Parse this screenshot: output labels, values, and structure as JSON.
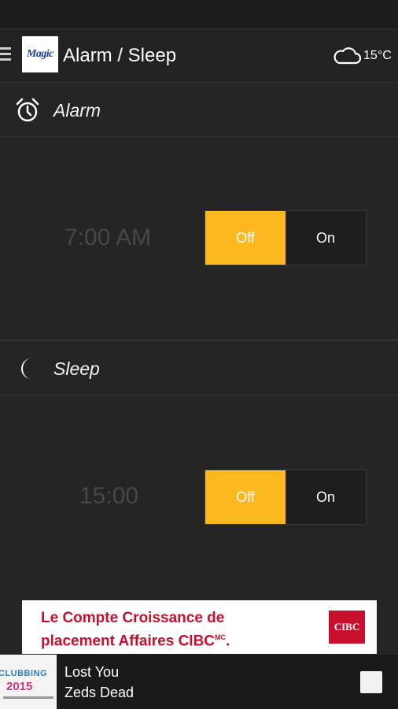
{
  "header": {
    "title": "Alarm / Sleep",
    "logo_text": "Magic",
    "temperature": "15°C"
  },
  "alarm": {
    "label": "Alarm",
    "time": "7:00 AM",
    "off_label": "Off",
    "on_label": "On",
    "state": "Off"
  },
  "sleep": {
    "label": "Sleep",
    "time": "15:00",
    "off_label": "Off",
    "on_label": "On",
    "state": "Off"
  },
  "ad": {
    "line1": "Le Compte Croissance de",
    "line2": "placement Affaires CIBC",
    "line2_sup": "MC",
    "line2_end": ".",
    "brand": "CIBC"
  },
  "player": {
    "album_line1": "CLUBBING",
    "album_line2": "2015",
    "song": "Lost You",
    "artist": "Zeds Dead"
  },
  "colors": {
    "accent": "#fbb81f",
    "background": "#252525",
    "brand_red": "#c8102e"
  }
}
